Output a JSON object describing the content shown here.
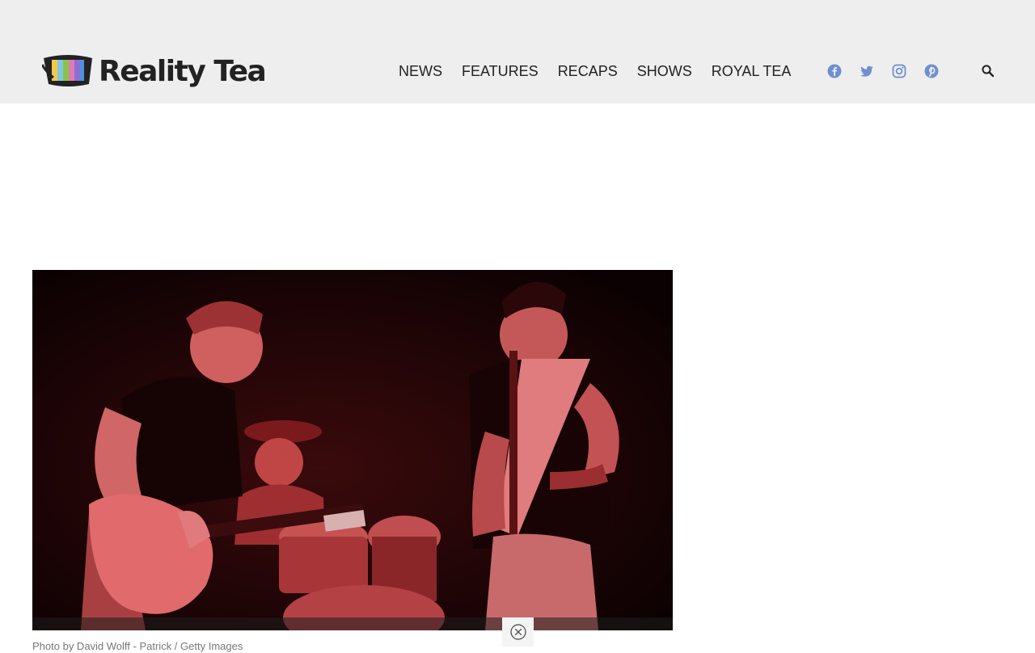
{
  "site": {
    "brand_name": "Reality Tea",
    "logo_icon": "tv-icon"
  },
  "nav": {
    "items": [
      {
        "label": "NEWS"
      },
      {
        "label": "FEATURES"
      },
      {
        "label": "RECAPS"
      },
      {
        "label": "SHOWS"
      },
      {
        "label": "ROYAL TEA"
      }
    ]
  },
  "social": {
    "icons": [
      "facebook-icon",
      "twitter-icon",
      "instagram-icon",
      "pinterest-icon"
    ],
    "color": "#6f8fd0"
  },
  "search": {
    "icon": "search-icon"
  },
  "article": {
    "caption": "Photo by David Wolff - Patrick / Getty Images"
  },
  "sticky_ad": {
    "close_icon": "close-icon"
  },
  "colors": {
    "header_bg": "#eeeeee",
    "accent_social": "#6f8fd0",
    "text": "#222222"
  }
}
